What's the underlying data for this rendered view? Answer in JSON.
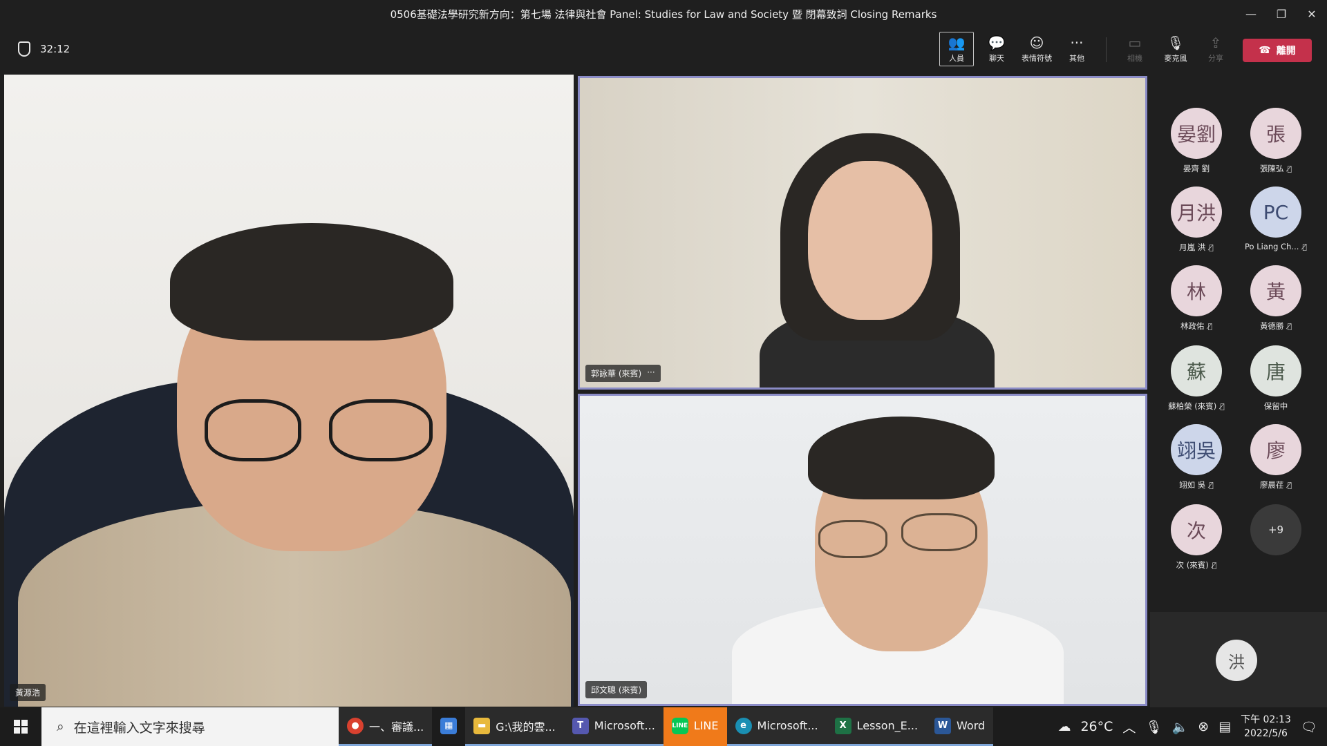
{
  "window": {
    "title": "0506基礎法學研究新方向：第七場 法律與社會 Panel: Studies for Law and Society 暨 閉幕致詞 Closing Remarks",
    "controls": [
      "—",
      "❐",
      "✕"
    ]
  },
  "toolbar": {
    "timer": "32:12",
    "buttons": [
      {
        "label": "人員",
        "icon": "people-icon"
      },
      {
        "label": "聊天",
        "icon": "chat-icon"
      },
      {
        "label": "表情符號",
        "icon": "reactions-icon"
      },
      {
        "label": "其他",
        "icon": "more-icon"
      },
      {
        "label": "相機",
        "icon": "camera-off-icon"
      },
      {
        "label": "麥克風",
        "icon": "mic-off-icon"
      },
      {
        "label": "分享",
        "icon": "share-icon"
      }
    ],
    "leave_label": "離開"
  },
  "videos": {
    "left_name": "黃源浩",
    "top_name": "郭詠華 (來賓)",
    "top_more": "···",
    "bottom_name": "邱文聰 (來賓)"
  },
  "participants": [
    {
      "initials": "晏劉",
      "name": "晏齊 劉",
      "muted": false,
      "style": "pink"
    },
    {
      "initials": "張",
      "name": "張陳弘",
      "muted": true,
      "style": "pink"
    },
    {
      "initials": "月洪",
      "name": "月嵐 洪",
      "muted": true,
      "style": "pink"
    },
    {
      "initials": "PC",
      "name": "Po Liang Ch...",
      "muted": true,
      "style": "blue"
    },
    {
      "initials": "林",
      "name": "林政佑",
      "muted": true,
      "style": "pink"
    },
    {
      "initials": "黃",
      "name": "黃德勝",
      "muted": true,
      "style": "pink"
    },
    {
      "initials": "蘇",
      "name": "蘇柏榮 (來賓)",
      "muted": true,
      "style": "green"
    },
    {
      "initials": "唐",
      "name": "保留中",
      "muted": false,
      "style": "green"
    },
    {
      "initials": "翊吳",
      "name": "翊如 吳",
      "muted": true,
      "style": "blue"
    },
    {
      "initials": "廖",
      "name": "廖晨荏",
      "muted": true,
      "style": "pink"
    },
    {
      "initials": "次",
      "name": "次 (來賓)",
      "muted": true,
      "style": "pink"
    },
    {
      "initials": "+9",
      "name": "",
      "muted": false,
      "style": "more"
    }
  ],
  "self": {
    "initials": "洪"
  },
  "taskbar": {
    "search_placeholder": "在這裡輸入文字來搜尋",
    "apps": [
      {
        "label": "一、審議...",
        "icon": "chrome-icon"
      },
      {
        "label": "",
        "icon": "store-icon"
      },
      {
        "label": "G:\\我的雲...",
        "icon": "folder-icon"
      },
      {
        "label": "Microsoft...",
        "icon": "teams-icon"
      },
      {
        "label": "LINE",
        "icon": "line-icon"
      },
      {
        "label": "Microsoft...",
        "icon": "edge-icon"
      },
      {
        "label": "Lesson_E...",
        "icon": "excel-icon"
      },
      {
        "label": "Word",
        "icon": "word-icon"
      }
    ],
    "weather": "26°C",
    "time": "下午 02:13",
    "date": "2022/5/6"
  },
  "colors": {
    "leave": "#c4314b",
    "spotlight_border": "#8b8cc7",
    "line": "#f07a1a"
  }
}
